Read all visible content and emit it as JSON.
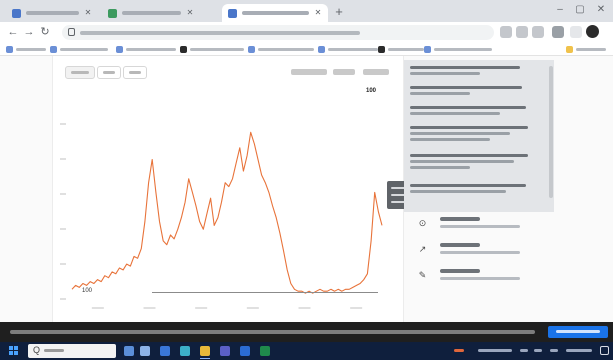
{
  "browser": {
    "tabs": [
      {
        "title": "",
        "active": false
      },
      {
        "title": "",
        "active": false
      },
      {
        "title": "",
        "active": true
      }
    ],
    "url": "",
    "bookmarks": [
      {
        "label": ""
      },
      {
        "label": ""
      },
      {
        "label": ""
      },
      {
        "label": ""
      },
      {
        "label": ""
      },
      {
        "label": ""
      },
      {
        "label": ""
      },
      {
        "label": ""
      }
    ]
  },
  "page": {
    "range_tabs": [
      {
        "label": "",
        "selected": true
      },
      {
        "label": ""
      },
      {
        "label": ""
      }
    ],
    "toolbar_options": [
      {
        "label": ""
      },
      {
        "label": ""
      },
      {
        "label": ""
      }
    ],
    "series_chip": "100",
    "footer_value": "100",
    "panel_items": [
      {
        "text": ""
      },
      {
        "text": ""
      },
      {
        "text": ""
      },
      {
        "text": ""
      },
      {
        "text": ""
      },
      {
        "text": ""
      }
    ],
    "list_items": [
      {
        "title": "",
        "subtitle": "",
        "icon": "pin-icon"
      },
      {
        "title": "",
        "subtitle": "",
        "icon": "link-icon"
      },
      {
        "title": "",
        "subtitle": "",
        "icon": "bookmark-icon"
      }
    ]
  },
  "chart_data": {
    "type": "line",
    "title": "",
    "xlabel": "",
    "ylabel": "",
    "grid": false,
    "series": [
      {
        "color": "#e8733a",
        "values": [
          5,
          7,
          6,
          8,
          7,
          9,
          8,
          10,
          9,
          12,
          11,
          14,
          13,
          16,
          15,
          18,
          17,
          22,
          21,
          26,
          40,
          60,
          72,
          55,
          40,
          30,
          28,
          33,
          31,
          36,
          42,
          50,
          62,
          55,
          48,
          40,
          36,
          44,
          52,
          38,
          42,
          50,
          60,
          58,
          62,
          70,
          78,
          66,
          74,
          86,
          80,
          72,
          64,
          60,
          55,
          48,
          42,
          34,
          25,
          15,
          8,
          5,
          4,
          4,
          3,
          4,
          3,
          4,
          5,
          4,
          4,
          5,
          4,
          5,
          4,
          5,
          5,
          6,
          7,
          8,
          10,
          13,
          30,
          55,
          45,
          38
        ]
      }
    ]
  },
  "cookie_banner": {
    "message": "",
    "accept_label": ""
  },
  "taskbar": {
    "search_icon_text": "Q",
    "search_placeholder": "",
    "pinned_apps": [
      {
        "icon": "file-explorer-icon"
      },
      {
        "icon": "store-icon"
      },
      {
        "icon": "mail-icon"
      },
      {
        "icon": "edge-icon"
      },
      {
        "icon": "chrome-icon"
      },
      {
        "icon": "teams-icon"
      },
      {
        "icon": "word-icon"
      },
      {
        "icon": "excel-icon"
      }
    ],
    "colors": {
      "accent": "#1a73e8",
      "taskbar": "#0f1f3d"
    }
  }
}
